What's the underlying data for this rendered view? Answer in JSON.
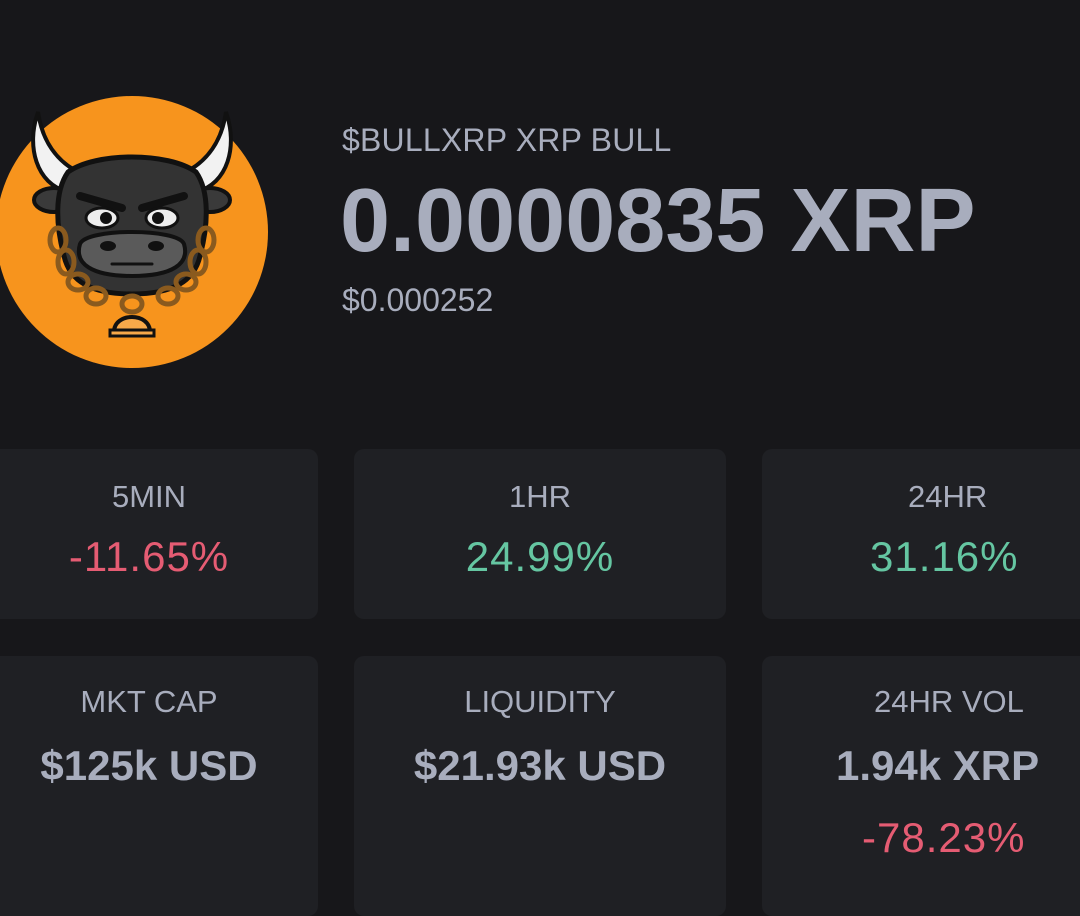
{
  "token": {
    "logo_icon": "bull-with-chain-icon",
    "ticker_line": "$BULLXRP XRP BULL",
    "price_xrp": "0.0000835 XRP",
    "price_usd": "$0.000252"
  },
  "colors": {
    "background": "#17171a",
    "card": "#1f2024",
    "text": "#a8adbd",
    "negative": "#e55c73",
    "positive": "#65c6a2",
    "logo_orange": "#f7941d"
  },
  "changes": [
    {
      "label": "5MIN",
      "value": "-11.65%",
      "direction": "negative"
    },
    {
      "label": "1HR",
      "value": "24.99%",
      "direction": "positive"
    },
    {
      "label": "24HR",
      "value": "31.16%",
      "direction": "positive"
    }
  ],
  "stats": [
    {
      "label": "MKT CAP",
      "value": "$125k USD"
    },
    {
      "label": "LIQUIDITY",
      "value": "$21.93k USD"
    },
    {
      "label": "24HR VOL",
      "value": "1.94k XRP",
      "change": "-78.23%",
      "change_direction": "negative"
    }
  ]
}
